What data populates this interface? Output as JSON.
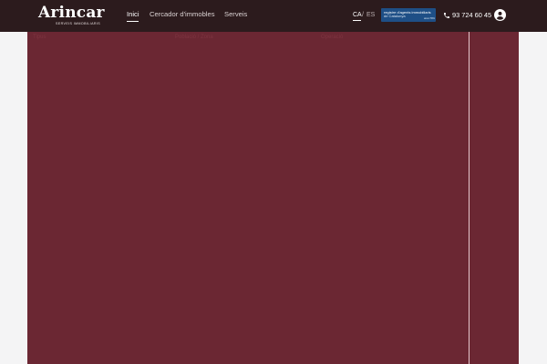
{
  "header": {
    "logo": {
      "wordmark": "Arincar",
      "tagline": "SERVEIS IMMOBILIARIS"
    },
    "nav": [
      {
        "label": "Inici",
        "active": true
      },
      {
        "label": "Cercador d'immobles",
        "active": false
      },
      {
        "label": "Serveis",
        "active": false
      }
    ],
    "languages": [
      {
        "label": "CA",
        "active": true
      },
      {
        "label": "ES",
        "active": false
      }
    ],
    "language_separator": "/",
    "registry_badge": {
      "line1": "registre d'agents immobiliaris",
      "line2": "de Catalunya",
      "line3": "aicat 7681"
    },
    "phone": "93 724 60 45",
    "icons": {
      "phone": "phone-icon",
      "account": "user-account-icon"
    }
  },
  "hero": {
    "ghost_labels": [
      "Tipus",
      "Població / Zona",
      "Operació"
    ]
  },
  "colors": {
    "header_bg": "#2c1b1d",
    "hero_bg": "#6b2733",
    "page_bg": "#f4f4f5",
    "badge_bg": "#1e4f86"
  }
}
